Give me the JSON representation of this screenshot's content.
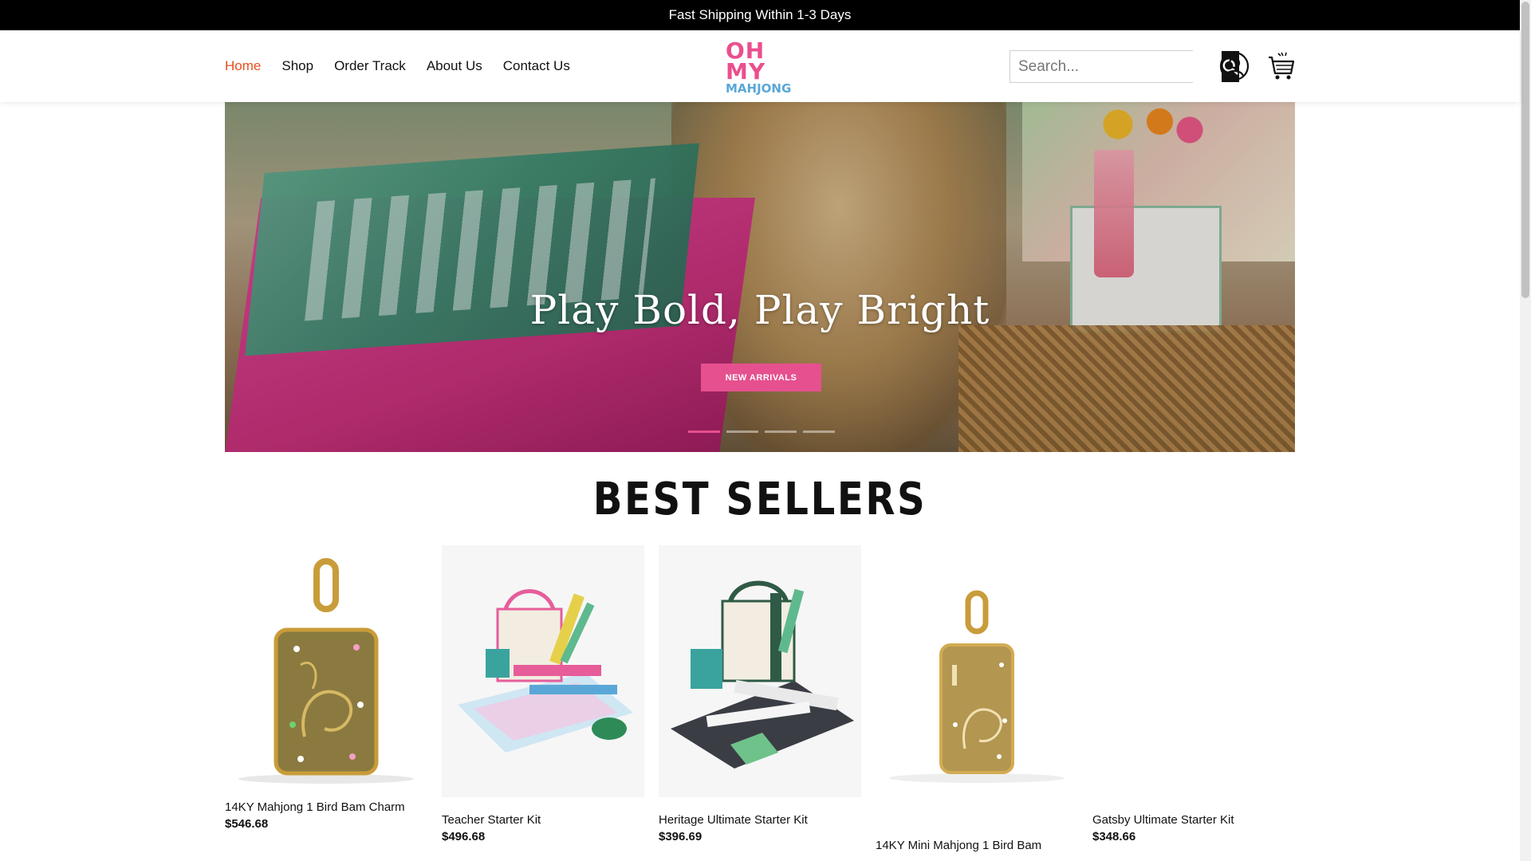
{
  "announcement": "Fast Shipping Within 1-3 Days",
  "nav": {
    "items": [
      {
        "label": "Home",
        "active": true
      },
      {
        "label": "Shop"
      },
      {
        "label": "Order Track"
      },
      {
        "label": "About Us"
      },
      {
        "label": "Contact Us"
      }
    ]
  },
  "logo": {
    "line1": "OH",
    "line2": "MY",
    "line3": "MAHJONG",
    "color_primary": "#ea4f8e",
    "color_secondary": "#5aa7d7"
  },
  "search": {
    "placeholder": "Search..."
  },
  "hero": {
    "title": "Play Bold, Play Bright",
    "button": "NEW ARRIVALS",
    "slides_count": 4,
    "active_slide": 1,
    "accent": "#e6508f"
  },
  "best_sellers": {
    "title": "BEST SELLERS",
    "products": [
      {
        "name": "14KY Mahjong 1 Bird Bam Charm",
        "price": "$546.68"
      },
      {
        "name": "Teacher Starter Kit",
        "price": "$496.68"
      },
      {
        "name": "Heritage Ultimate Starter Kit",
        "price": "$396.69"
      },
      {
        "name": "14KY Mini Mahjong 1 Bird Bam",
        "price": ""
      },
      {
        "name": "Gatsby Ultimate Starter Kit",
        "price": "$348.66"
      }
    ]
  },
  "colors": {
    "nav_active": "#e8501e",
    "announce_bg": "#000000"
  }
}
